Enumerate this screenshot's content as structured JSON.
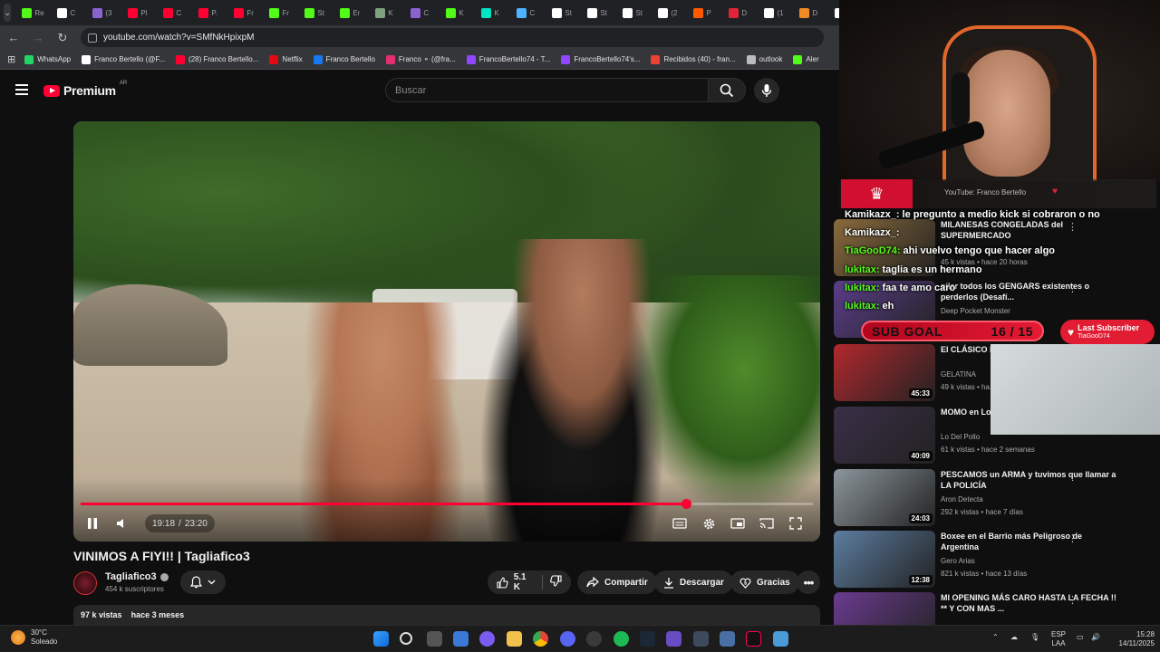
{
  "browser": {
    "tabs": [
      {
        "label": "Re",
        "color": "#53fc18"
      },
      {
        "label": "C",
        "color": "#ffffff"
      },
      {
        "label": "(3",
        "color": "#8a63d2"
      },
      {
        "label": "Pl",
        "color": "#ff0033"
      },
      {
        "label": "C",
        "color": "#ff0033"
      },
      {
        "label": "P.",
        "color": "#ff0033"
      },
      {
        "label": "Fr",
        "color": "#ff0033"
      },
      {
        "label": "Fr",
        "color": "#53fc18"
      },
      {
        "label": "St",
        "color": "#53fc18"
      },
      {
        "label": "Er",
        "color": "#53fc18"
      },
      {
        "label": "K",
        "color": "#7ea27e"
      },
      {
        "label": "C",
        "color": "#8a63d2"
      },
      {
        "label": "K",
        "color": "#53fc18"
      },
      {
        "label": "K",
        "color": "#00e5c4"
      },
      {
        "label": "C",
        "color": "#4db5ff"
      },
      {
        "label": "St",
        "color": "#ffffff"
      },
      {
        "label": "St",
        "color": "#ffffff"
      },
      {
        "label": "St",
        "color": "#ffffff"
      },
      {
        "label": "(2",
        "color": "#ffffff"
      },
      {
        "label": "P",
        "color": "#ff5a00"
      },
      {
        "label": "D",
        "color": "#e0243a"
      },
      {
        "label": "(1",
        "color": "#ffffff"
      },
      {
        "label": "D",
        "color": "#f08a24"
      },
      {
        "label": "(2",
        "color": "#ffffff"
      }
    ],
    "url": "youtube.com/watch?v=SMfNkHpixpM",
    "bookmarks": [
      {
        "label": "WhatsApp",
        "color": "#25d366"
      },
      {
        "label": "Franco Bertello (@F...",
        "color": "#ffffff"
      },
      {
        "label": "(28) Franco Bertello...",
        "color": "#ff0033"
      },
      {
        "label": "Netflix",
        "color": "#e50914"
      },
      {
        "label": "Franco Bertello",
        "color": "#1877f2"
      },
      {
        "label": "Franco ⚬ (@fra...",
        "color": "#e1306c"
      },
      {
        "label": "FrancoBertello74 - T...",
        "color": "#9146ff"
      },
      {
        "label": "FrancoBertello74's...",
        "color": "#9146ff"
      },
      {
        "label": "Recibidos (40) - fran...",
        "color": "#ea4335"
      },
      {
        "label": "outlook",
        "color": "#bbbbbb"
      },
      {
        "label": "Aler",
        "color": "#53fc18"
      }
    ]
  },
  "youtube": {
    "logo_text": "Premium",
    "country": "AR",
    "search_placeholder": "Buscar",
    "video": {
      "current_time": "19:18",
      "separator": "/",
      "duration": "23:20",
      "progress": 0.8271
    },
    "title": "VINIMOS A FIYI!! | Tagliafico3",
    "channel": {
      "name": "Tagliafico3",
      "subscribers": "454 k suscriptores"
    },
    "actions": {
      "likes": "5.1 K",
      "share": "Compartir",
      "download": "Descargar",
      "thanks": "Gracias"
    },
    "description": {
      "views": "97 k vistas",
      "date": "hace 3 meses"
    }
  },
  "recommendations": [
    {
      "title": "MILANESAS CONGELADAS del SUPERMERCADO",
      "channel": "",
      "meta": "45 k vistas • hace 20 horas",
      "duration": "",
      "thumb": "#8a6b3c"
    },
    {
      "title": "pilar todos los GENGARS existentes o perderlos (Desafí...",
      "channel": "Deep Pocket Monster",
      "meta": "",
      "duration": "",
      "thumb": "#5b3d8a"
    },
    {
      "title": "El CLÁSICO M... DE ROSARIO",
      "channel": "GELATINA",
      "meta": "49 k vistas • ha...",
      "duration": "45:33",
      "thumb": "#b2282d"
    },
    {
      "title": "MOMO en Lo... también me p...",
      "channel": "Lo Del Pollo",
      "meta": "61 k vistas • hace 2 semanas",
      "duration": "40:09",
      "thumb": "#3a2f47"
    },
    {
      "title": "PESCAMOS un ARMA y tuvimos que llamar a LA POLICÍA",
      "channel": "Aron Detecta",
      "meta": "292 k vistas • hace 7 días",
      "duration": "24:03",
      "thumb": "#8c969c"
    },
    {
      "title": "Boxee en el Barrio más Peligroso de Argentina",
      "channel": "Gero Arias",
      "meta": "821 k vistas • hace 13 días",
      "duration": "12:38",
      "thumb": "#5c7da0"
    },
    {
      "title": "MI OPENING MÁS CARO HASTA LA FECHA !! ** Y CON MAS ...",
      "channel": "",
      "meta": "",
      "duration": "",
      "thumb": "#6a3b8f"
    }
  ],
  "overlay": {
    "alert_text": "YouTube: Franco Bertello",
    "chat": [
      {
        "user": "Kamikazx_:",
        "msg": "le pregunto a medio kick si cobraron o no",
        "color": "#ffffff"
      },
      {
        "user": "Kamikazx_:",
        "msg": "",
        "color": "#ffffff"
      },
      {
        "user": "TiaGooD74:",
        "msg": "ahi vuelvo tengo que hacer algo",
        "color": "#53fc18"
      },
      {
        "user": "lukitax:",
        "msg": "taglia es un hermano",
        "color": "#53fc18"
      },
      {
        "user": "lukitax:",
        "msg": "faa te amo caro",
        "color": "#53fc18"
      },
      {
        "user": "lukitax:",
        "msg": "eh",
        "color": "#53fc18"
      }
    ],
    "subgoal": {
      "label": "SUB GOAL",
      "count": "16 / 15"
    },
    "last_subscriber": {
      "label": "Last Subscriber",
      "name": "TiaGooD74"
    }
  },
  "taskbar": {
    "weather": {
      "temp": "30°C",
      "condition": "Soleado"
    },
    "language": {
      "lang": "ESP",
      "layout": "LAA"
    },
    "clock": {
      "time": "15:28",
      "date": "14/11/2025"
    }
  }
}
